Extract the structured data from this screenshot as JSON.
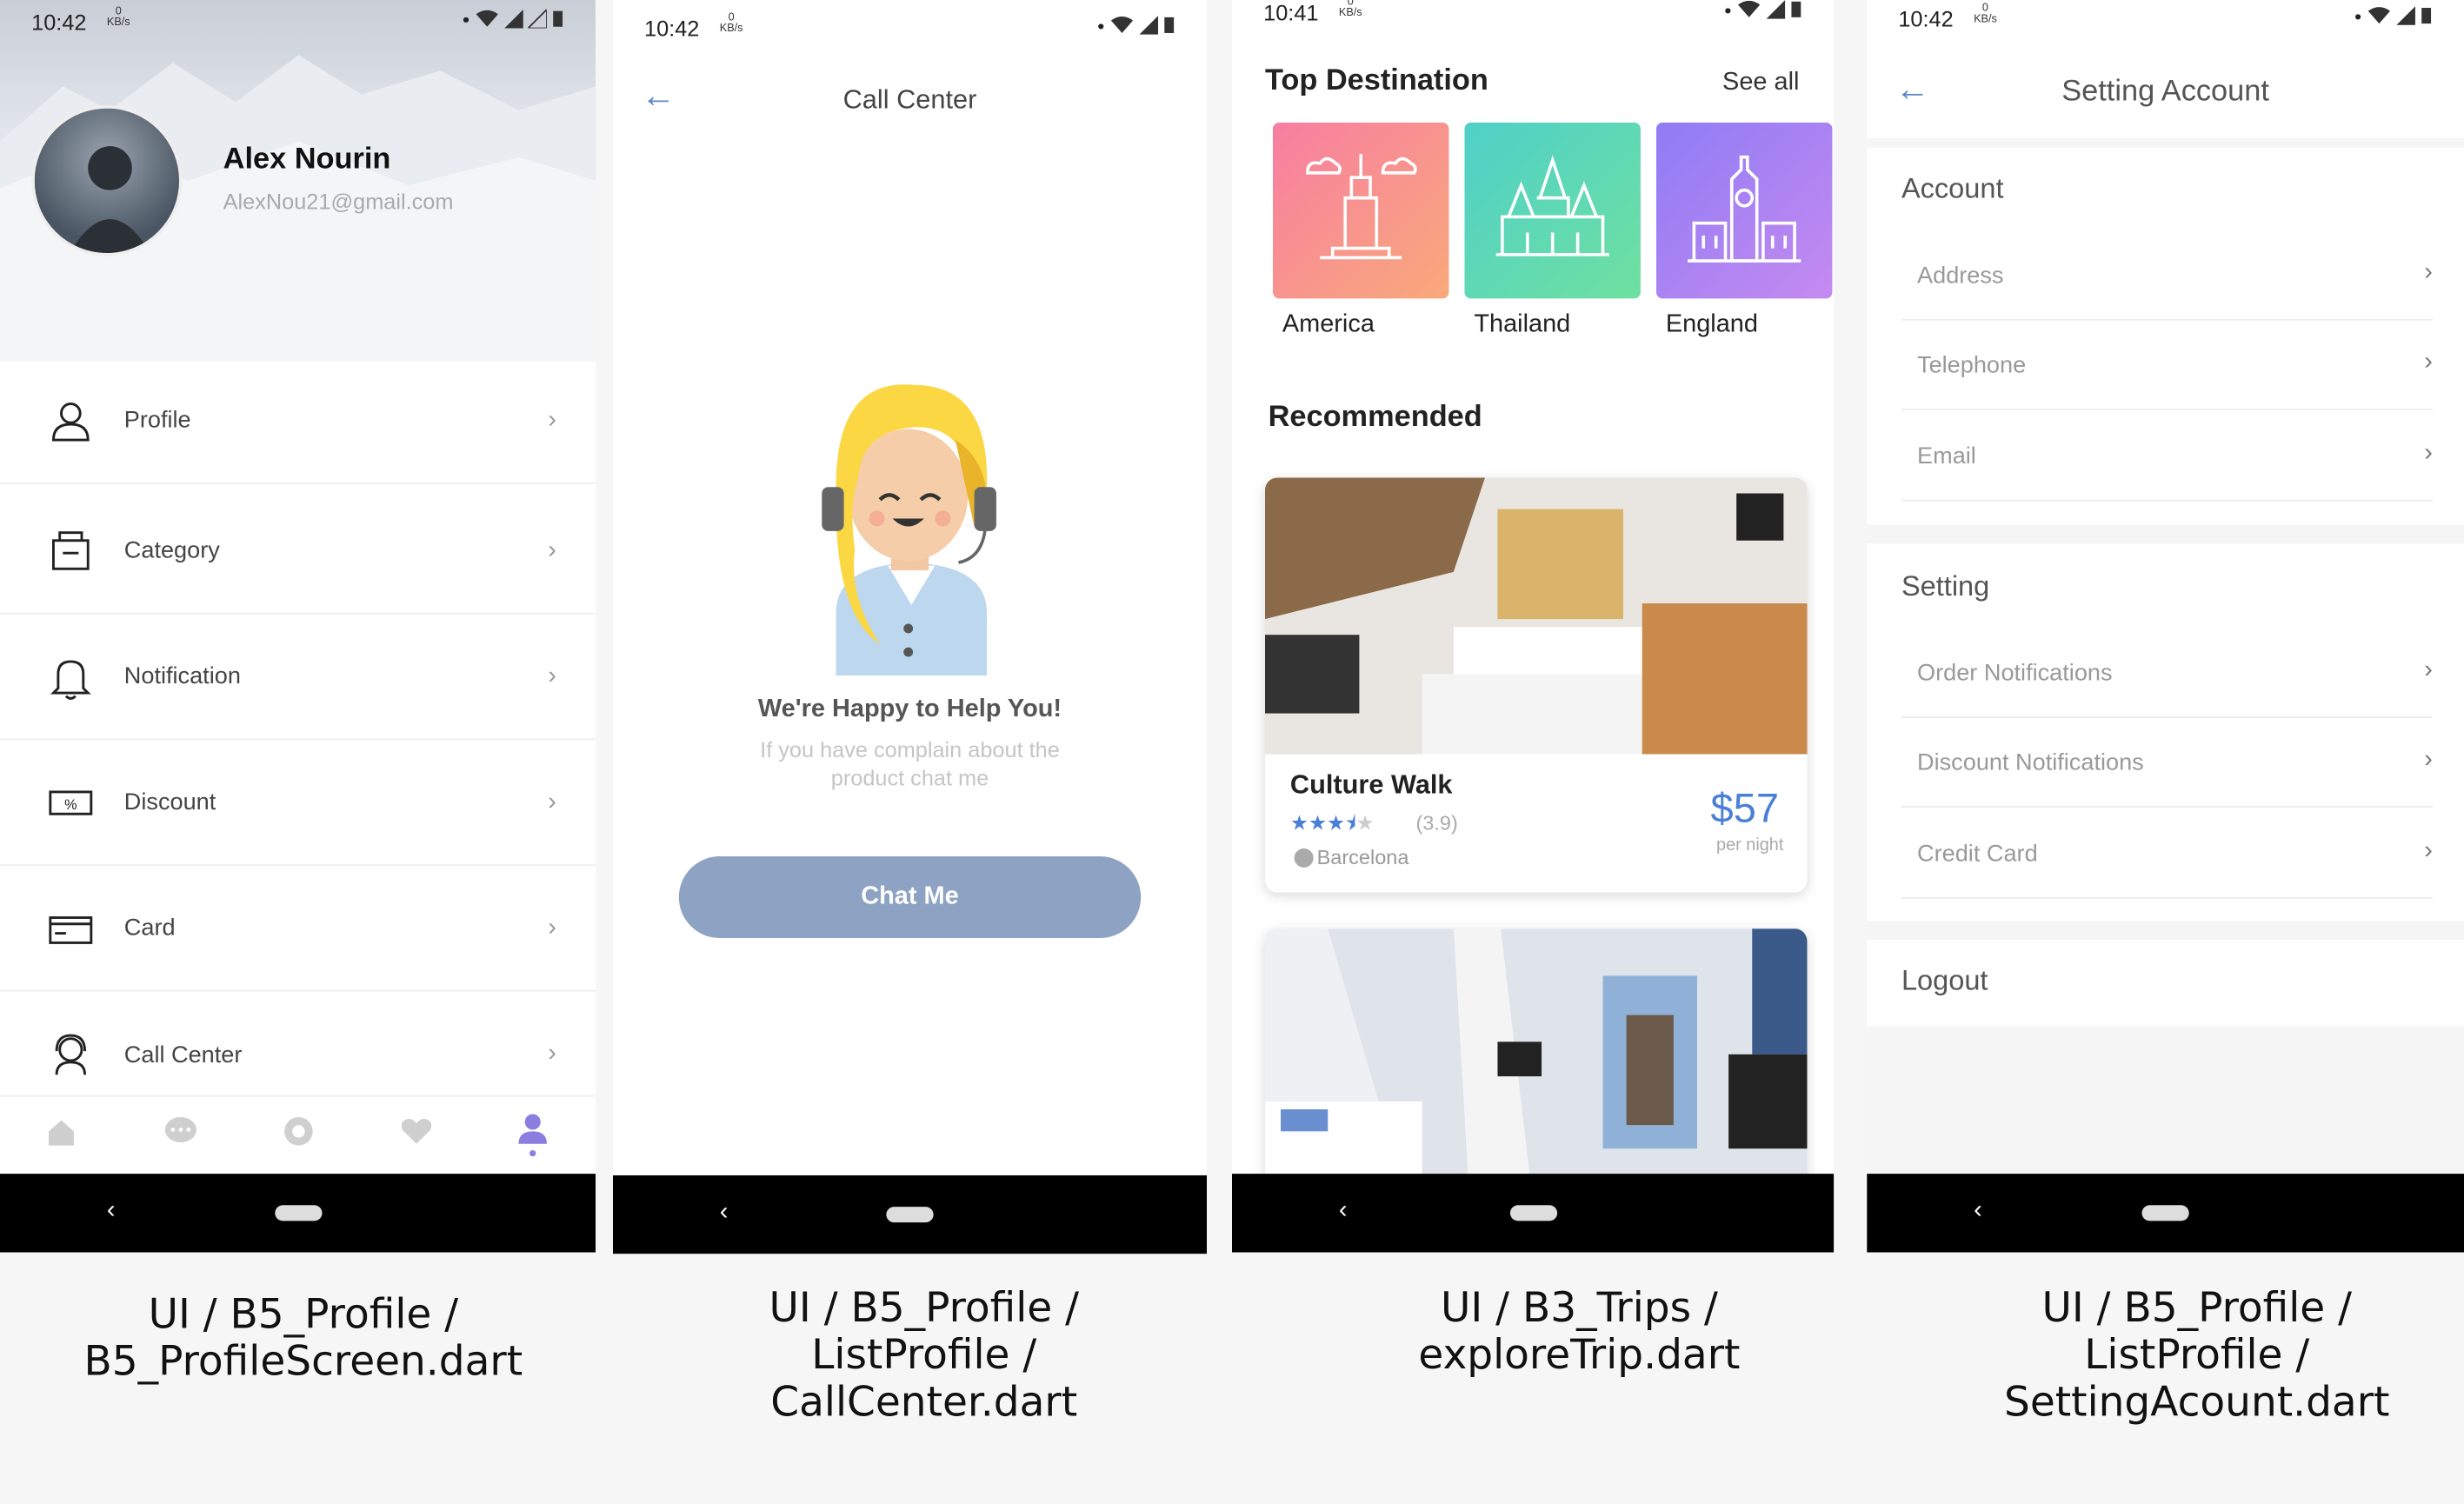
{
  "status": {
    "time1": "10:42",
    "time2": "10:42",
    "time3": "10:41",
    "time4": "10:42",
    "kb_num": "0",
    "kb_unit": "KB/s"
  },
  "profile": {
    "name": "Alex Nourin",
    "email": "AlexNou21@gmail.com",
    "items": [
      {
        "label": "Profile",
        "icon": "user-icon"
      },
      {
        "label": "Category",
        "icon": "category-icon"
      },
      {
        "label": "Notification",
        "icon": "bell-icon"
      },
      {
        "label": "Discount",
        "icon": "discount-icon"
      },
      {
        "label": "Card",
        "icon": "card-icon"
      },
      {
        "label": "Call Center",
        "icon": "headset-icon"
      }
    ],
    "bottom_nav": [
      "home-icon",
      "chat-icon",
      "explore-icon",
      "heart-icon",
      "profile-icon"
    ],
    "accent": "#8a7fe0"
  },
  "callcenter": {
    "title": "Call Center",
    "headline": "We're Happy to Help You!",
    "subtitle_line1": "If you have complain about the",
    "subtitle_line2": "product chat me",
    "button": "Chat Me",
    "button_color": "#8ea3c4"
  },
  "explore": {
    "top_title": "Top Destination",
    "see_all": "See all",
    "destinations": [
      {
        "label": "America",
        "icon": "empire-state-icon"
      },
      {
        "label": "Thailand",
        "icon": "temple-icon"
      },
      {
        "label": "England",
        "icon": "big-ben-icon"
      }
    ],
    "recommended": "Recommended",
    "card": {
      "title": "Culture Walk",
      "rating": "(3.9)",
      "location": "Barcelona",
      "price": "$57",
      "per": "per night"
    }
  },
  "setting": {
    "title": "Setting Account",
    "account_head": "Account",
    "account_items": [
      "Address",
      "Telephone",
      "Email"
    ],
    "setting_head": "Setting",
    "setting_items": [
      "Order Notifications",
      "Discount Notifications",
      "Credit Card"
    ],
    "logout": "Logout"
  },
  "captions": {
    "c1a": "UI /  B5_Profile /",
    "c1b": "B5_ProfileScreen.dart",
    "c2a": "UI /  B5_Profile /",
    "c2b": "ListProfile /",
    "c2c": "CallCenter.dart",
    "c3a": "UI /  B3_Trips /",
    "c3b": "exploreTrip.dart",
    "c4a": "UI /  B5_Profile /",
    "c4b": "ListProfile /",
    "c4c": "SettingAcount.dart"
  }
}
